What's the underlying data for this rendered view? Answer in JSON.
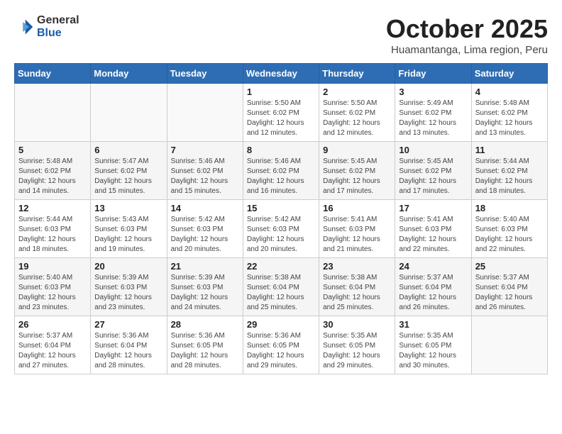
{
  "logo": {
    "general": "General",
    "blue": "Blue"
  },
  "header": {
    "title": "October 2025",
    "subtitle": "Huamantanga, Lima region, Peru"
  },
  "weekdays": [
    "Sunday",
    "Monday",
    "Tuesday",
    "Wednesday",
    "Thursday",
    "Friday",
    "Saturday"
  ],
  "weeks": [
    [
      {
        "day": "",
        "info": ""
      },
      {
        "day": "",
        "info": ""
      },
      {
        "day": "",
        "info": ""
      },
      {
        "day": "1",
        "info": "Sunrise: 5:50 AM\nSunset: 6:02 PM\nDaylight: 12 hours and 12 minutes."
      },
      {
        "day": "2",
        "info": "Sunrise: 5:50 AM\nSunset: 6:02 PM\nDaylight: 12 hours and 12 minutes."
      },
      {
        "day": "3",
        "info": "Sunrise: 5:49 AM\nSunset: 6:02 PM\nDaylight: 12 hours and 13 minutes."
      },
      {
        "day": "4",
        "info": "Sunrise: 5:48 AM\nSunset: 6:02 PM\nDaylight: 12 hours and 13 minutes."
      }
    ],
    [
      {
        "day": "5",
        "info": "Sunrise: 5:48 AM\nSunset: 6:02 PM\nDaylight: 12 hours and 14 minutes."
      },
      {
        "day": "6",
        "info": "Sunrise: 5:47 AM\nSunset: 6:02 PM\nDaylight: 12 hours and 15 minutes."
      },
      {
        "day": "7",
        "info": "Sunrise: 5:46 AM\nSunset: 6:02 PM\nDaylight: 12 hours and 15 minutes."
      },
      {
        "day": "8",
        "info": "Sunrise: 5:46 AM\nSunset: 6:02 PM\nDaylight: 12 hours and 16 minutes."
      },
      {
        "day": "9",
        "info": "Sunrise: 5:45 AM\nSunset: 6:02 PM\nDaylight: 12 hours and 17 minutes."
      },
      {
        "day": "10",
        "info": "Sunrise: 5:45 AM\nSunset: 6:02 PM\nDaylight: 12 hours and 17 minutes."
      },
      {
        "day": "11",
        "info": "Sunrise: 5:44 AM\nSunset: 6:02 PM\nDaylight: 12 hours and 18 minutes."
      }
    ],
    [
      {
        "day": "12",
        "info": "Sunrise: 5:44 AM\nSunset: 6:03 PM\nDaylight: 12 hours and 18 minutes."
      },
      {
        "day": "13",
        "info": "Sunrise: 5:43 AM\nSunset: 6:03 PM\nDaylight: 12 hours and 19 minutes."
      },
      {
        "day": "14",
        "info": "Sunrise: 5:42 AM\nSunset: 6:03 PM\nDaylight: 12 hours and 20 minutes."
      },
      {
        "day": "15",
        "info": "Sunrise: 5:42 AM\nSunset: 6:03 PM\nDaylight: 12 hours and 20 minutes."
      },
      {
        "day": "16",
        "info": "Sunrise: 5:41 AM\nSunset: 6:03 PM\nDaylight: 12 hours and 21 minutes."
      },
      {
        "day": "17",
        "info": "Sunrise: 5:41 AM\nSunset: 6:03 PM\nDaylight: 12 hours and 22 minutes."
      },
      {
        "day": "18",
        "info": "Sunrise: 5:40 AM\nSunset: 6:03 PM\nDaylight: 12 hours and 22 minutes."
      }
    ],
    [
      {
        "day": "19",
        "info": "Sunrise: 5:40 AM\nSunset: 6:03 PM\nDaylight: 12 hours and 23 minutes."
      },
      {
        "day": "20",
        "info": "Sunrise: 5:39 AM\nSunset: 6:03 PM\nDaylight: 12 hours and 23 minutes."
      },
      {
        "day": "21",
        "info": "Sunrise: 5:39 AM\nSunset: 6:03 PM\nDaylight: 12 hours and 24 minutes."
      },
      {
        "day": "22",
        "info": "Sunrise: 5:38 AM\nSunset: 6:04 PM\nDaylight: 12 hours and 25 minutes."
      },
      {
        "day": "23",
        "info": "Sunrise: 5:38 AM\nSunset: 6:04 PM\nDaylight: 12 hours and 25 minutes."
      },
      {
        "day": "24",
        "info": "Sunrise: 5:37 AM\nSunset: 6:04 PM\nDaylight: 12 hours and 26 minutes."
      },
      {
        "day": "25",
        "info": "Sunrise: 5:37 AM\nSunset: 6:04 PM\nDaylight: 12 hours and 26 minutes."
      }
    ],
    [
      {
        "day": "26",
        "info": "Sunrise: 5:37 AM\nSunset: 6:04 PM\nDaylight: 12 hours and 27 minutes."
      },
      {
        "day": "27",
        "info": "Sunrise: 5:36 AM\nSunset: 6:04 PM\nDaylight: 12 hours and 28 minutes."
      },
      {
        "day": "28",
        "info": "Sunrise: 5:36 AM\nSunset: 6:05 PM\nDaylight: 12 hours and 28 minutes."
      },
      {
        "day": "29",
        "info": "Sunrise: 5:36 AM\nSunset: 6:05 PM\nDaylight: 12 hours and 29 minutes."
      },
      {
        "day": "30",
        "info": "Sunrise: 5:35 AM\nSunset: 6:05 PM\nDaylight: 12 hours and 29 minutes."
      },
      {
        "day": "31",
        "info": "Sunrise: 5:35 AM\nSunset: 6:05 PM\nDaylight: 12 hours and 30 minutes."
      },
      {
        "day": "",
        "info": ""
      }
    ]
  ]
}
